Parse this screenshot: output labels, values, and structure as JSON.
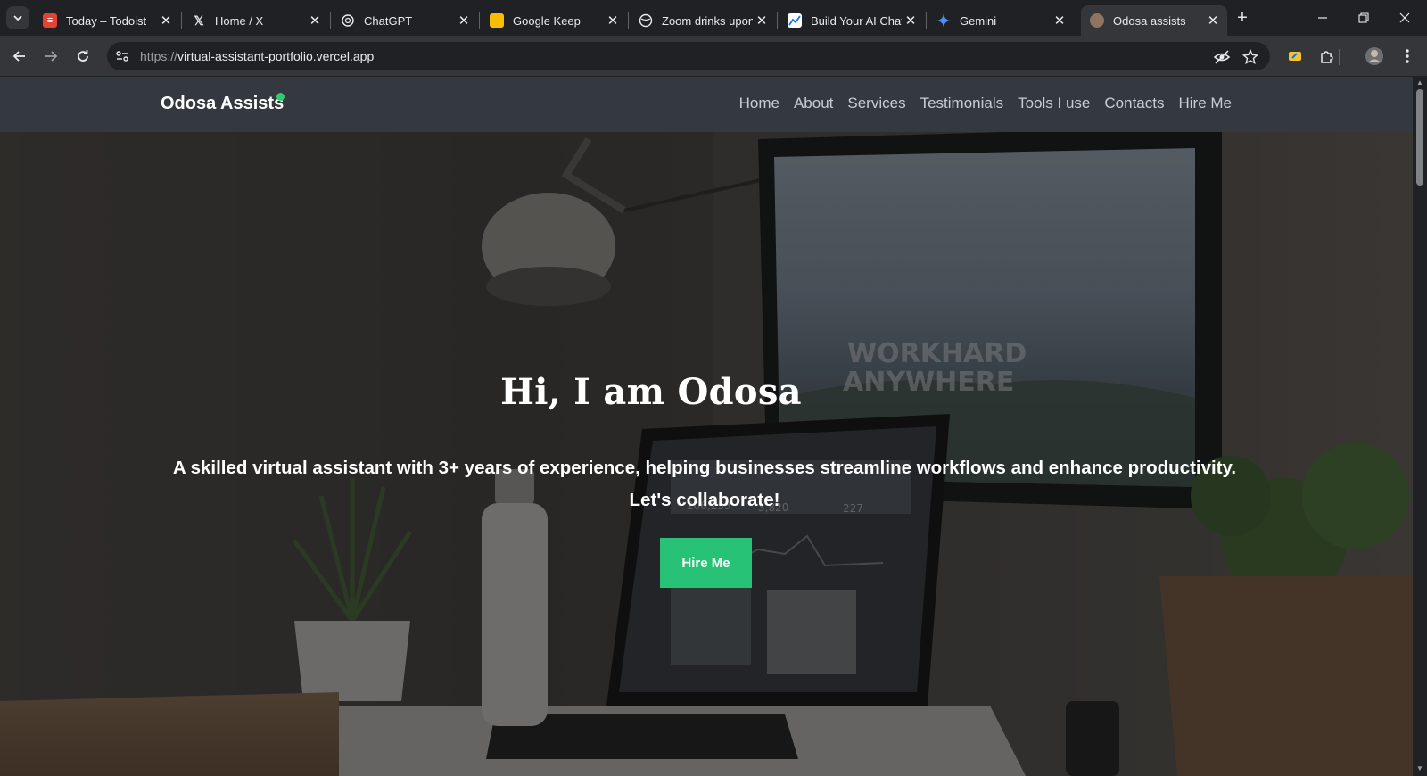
{
  "browser": {
    "tabs": [
      {
        "title": "Today – Todoist",
        "icon": "todoist-icon",
        "active": false
      },
      {
        "title": "Home / X",
        "icon": "x-logo-icon",
        "active": false
      },
      {
        "title": "ChatGPT",
        "icon": "chatgpt-icon",
        "active": false
      },
      {
        "title": "Google Keep",
        "icon": "google-keep-icon",
        "active": false
      },
      {
        "title": "Zoom drinks upon",
        "icon": "globe-icon",
        "active": false
      },
      {
        "title": "Build Your AI Chat",
        "icon": "chart-icon",
        "active": false
      },
      {
        "title": "Gemini",
        "icon": "gemini-icon",
        "active": false
      },
      {
        "title": "Odosa assists",
        "icon": "site-favicon-icon",
        "active": true
      }
    ],
    "address_bar": {
      "protocol": "https://",
      "host": "virtual-assistant-portfolio.vercel.app"
    }
  },
  "site": {
    "brand": "Odosa Assists",
    "nav": [
      "Home",
      "About",
      "Services",
      "Testimonials",
      "Tools I use",
      "Contacts",
      "Hire Me"
    ],
    "hero": {
      "title": "Hi, I am Odosa",
      "subtitle": "A skilled virtual assistant with 3+ years of experience, helping businesses streamline workflows and enhance productivity. Let's collaborate!",
      "cta": "Hire Me"
    },
    "background_art": {
      "screen_line1": "WORKHARD",
      "screen_line2": "ANYWHERE",
      "stat1": "206,253",
      "stat2": "3,820",
      "stat3": "227"
    }
  },
  "colors": {
    "accent": "#27c275",
    "navbar": "#33393f",
    "chrome_dark": "#202124",
    "chrome_toolbar": "#35363a"
  }
}
